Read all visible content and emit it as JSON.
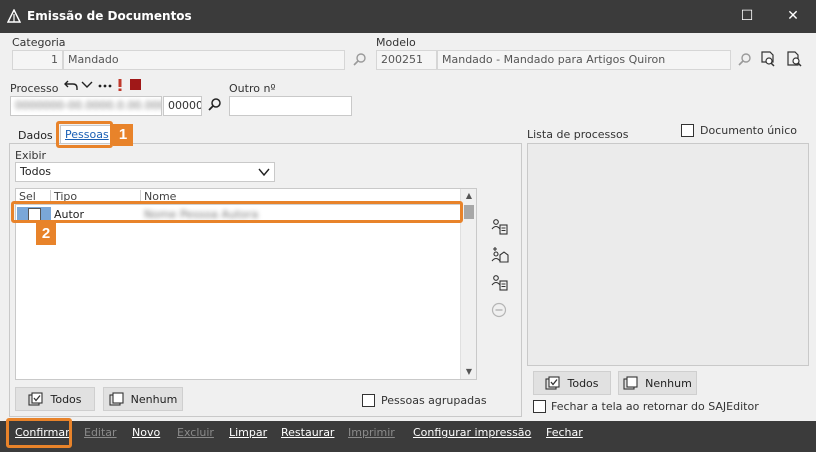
{
  "window": {
    "title": "Emissão de Documentos",
    "maximize_glyph": "☐",
    "close_glyph": "✕"
  },
  "categoria": {
    "label": "Categoria",
    "code": "1",
    "name": "Mandado"
  },
  "modelo": {
    "label": "Modelo",
    "code": "200251",
    "name": "Mandado - Mandado para Artigos Quiron"
  },
  "processo": {
    "label": "Processo",
    "number": "0000000-00.0000.0.00.0000",
    "suffix": "00000"
  },
  "outro": {
    "label": "Outro nº",
    "value": ""
  },
  "tabs": {
    "dados": "Dados",
    "pessoas": "Pessoas"
  },
  "exibir": {
    "label": "Exibir",
    "selected": "Todos"
  },
  "grid": {
    "columns": [
      "Sel",
      "Tipo",
      "Nome"
    ],
    "rows": [
      {
        "tipo": "Autor",
        "nome": "Nome Pessoa Autora"
      }
    ]
  },
  "left_buttons": {
    "todos": "Todos",
    "nenhum": "Nenhum"
  },
  "pessoas_agrupadas": "Pessoas agrupadas",
  "lista_processos": "Lista de processos",
  "documento_unico": "Documento único",
  "right_buttons": {
    "todos": "Todos",
    "nenhum": "Nenhum"
  },
  "fechar_tela": "Fechar a tela ao retornar do SAJEditor",
  "badges": {
    "one": "1",
    "two": "2"
  },
  "footer": {
    "confirmar": "Confirmar",
    "editar": "Editar",
    "novo": "Novo",
    "excluir": "Excluir",
    "limpar": "Limpar",
    "restaurar": "Restaurar",
    "imprimir": "Imprimir",
    "configurar": "Configurar impressão",
    "fechar": "Fechar"
  },
  "colors": {
    "accent": "#e8832a",
    "titlebar": "#3b3b3b",
    "selection": "#7aa7d8",
    "link": "#1a5fb4"
  }
}
